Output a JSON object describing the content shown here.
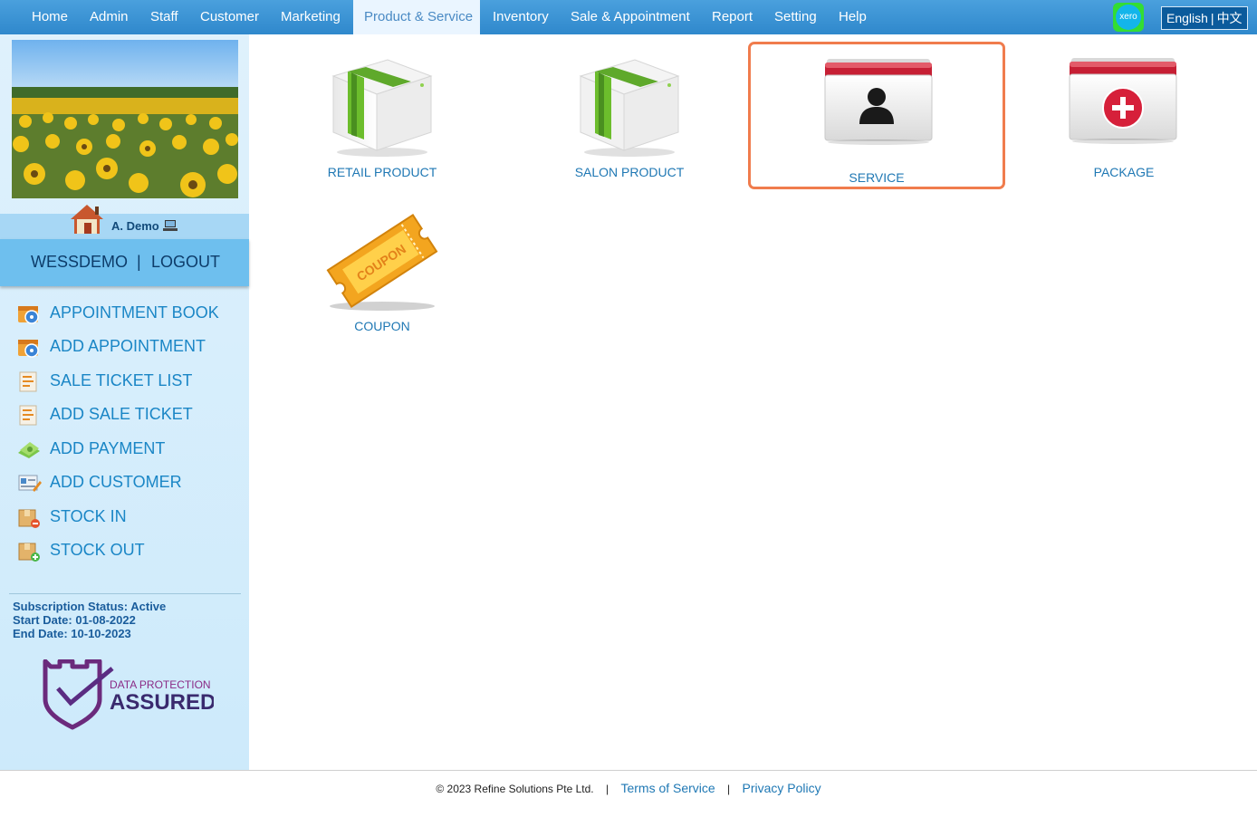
{
  "nav": {
    "items": [
      {
        "label": "Home"
      },
      {
        "label": "Admin"
      },
      {
        "label": "Staff"
      },
      {
        "label": "Customer"
      },
      {
        "label": "Marketing"
      },
      {
        "label": "Product & Service"
      },
      {
        "label": "Inventory"
      },
      {
        "label": "Sale & Appointment"
      },
      {
        "label": "Report"
      },
      {
        "label": "Setting"
      },
      {
        "label": "Help"
      }
    ],
    "active": "Product & Service",
    "xero_label": "xero",
    "lang_english": "English",
    "lang_separator": "|",
    "lang_chinese": "中文"
  },
  "sidebar": {
    "username": "A. Demo",
    "account": "WESSDEMO",
    "account_sep": "|",
    "logout": "LOGOUT",
    "menu": [
      {
        "label": "APPOINTMENT BOOK",
        "icon": "calendar-clock-icon"
      },
      {
        "label": "ADD APPOINTMENT",
        "icon": "calendar-clock-icon"
      },
      {
        "label": "SALE TICKET LIST",
        "icon": "receipt-icon"
      },
      {
        "label": "ADD SALE TICKET",
        "icon": "receipt-icon"
      },
      {
        "label": "ADD PAYMENT",
        "icon": "money-icon"
      },
      {
        "label": "ADD CUSTOMER",
        "icon": "customer-card-icon"
      },
      {
        "label": "STOCK IN",
        "icon": "box-in-icon"
      },
      {
        "label": "STOCK OUT",
        "icon": "box-out-icon"
      }
    ],
    "subscription_status": "Subscription Status: Active",
    "start_date": "Start Date: 01-08-2022",
    "end_date": "End Date: 10-10-2023",
    "dpa_line1": "DATA PROTECTION",
    "dpa_line2": "ASSURED"
  },
  "main": {
    "tiles": [
      {
        "label": "RETAIL PRODUCT",
        "icon": "product-box-icon"
      },
      {
        "label": "SALON PRODUCT",
        "icon": "product-box-icon"
      },
      {
        "label": "SERVICE",
        "icon": "service-folder-icon",
        "selected": true
      },
      {
        "label": "PACKAGE",
        "icon": "package-folder-icon"
      },
      {
        "label": "COUPON",
        "icon": "coupon-icon",
        "icon_text": "COUPON"
      }
    ]
  },
  "footer": {
    "copyright": "© 2023 Refine Solutions Pte Ltd.",
    "terms": "Terms of Service",
    "privacy": "Privacy Policy",
    "sep": "|"
  },
  "colors": {
    "nav_bg": "#3a93d3",
    "sidebar_bg": "#d4ecfb",
    "link": "#1f78b4",
    "selected_border": "#f07c4d"
  }
}
